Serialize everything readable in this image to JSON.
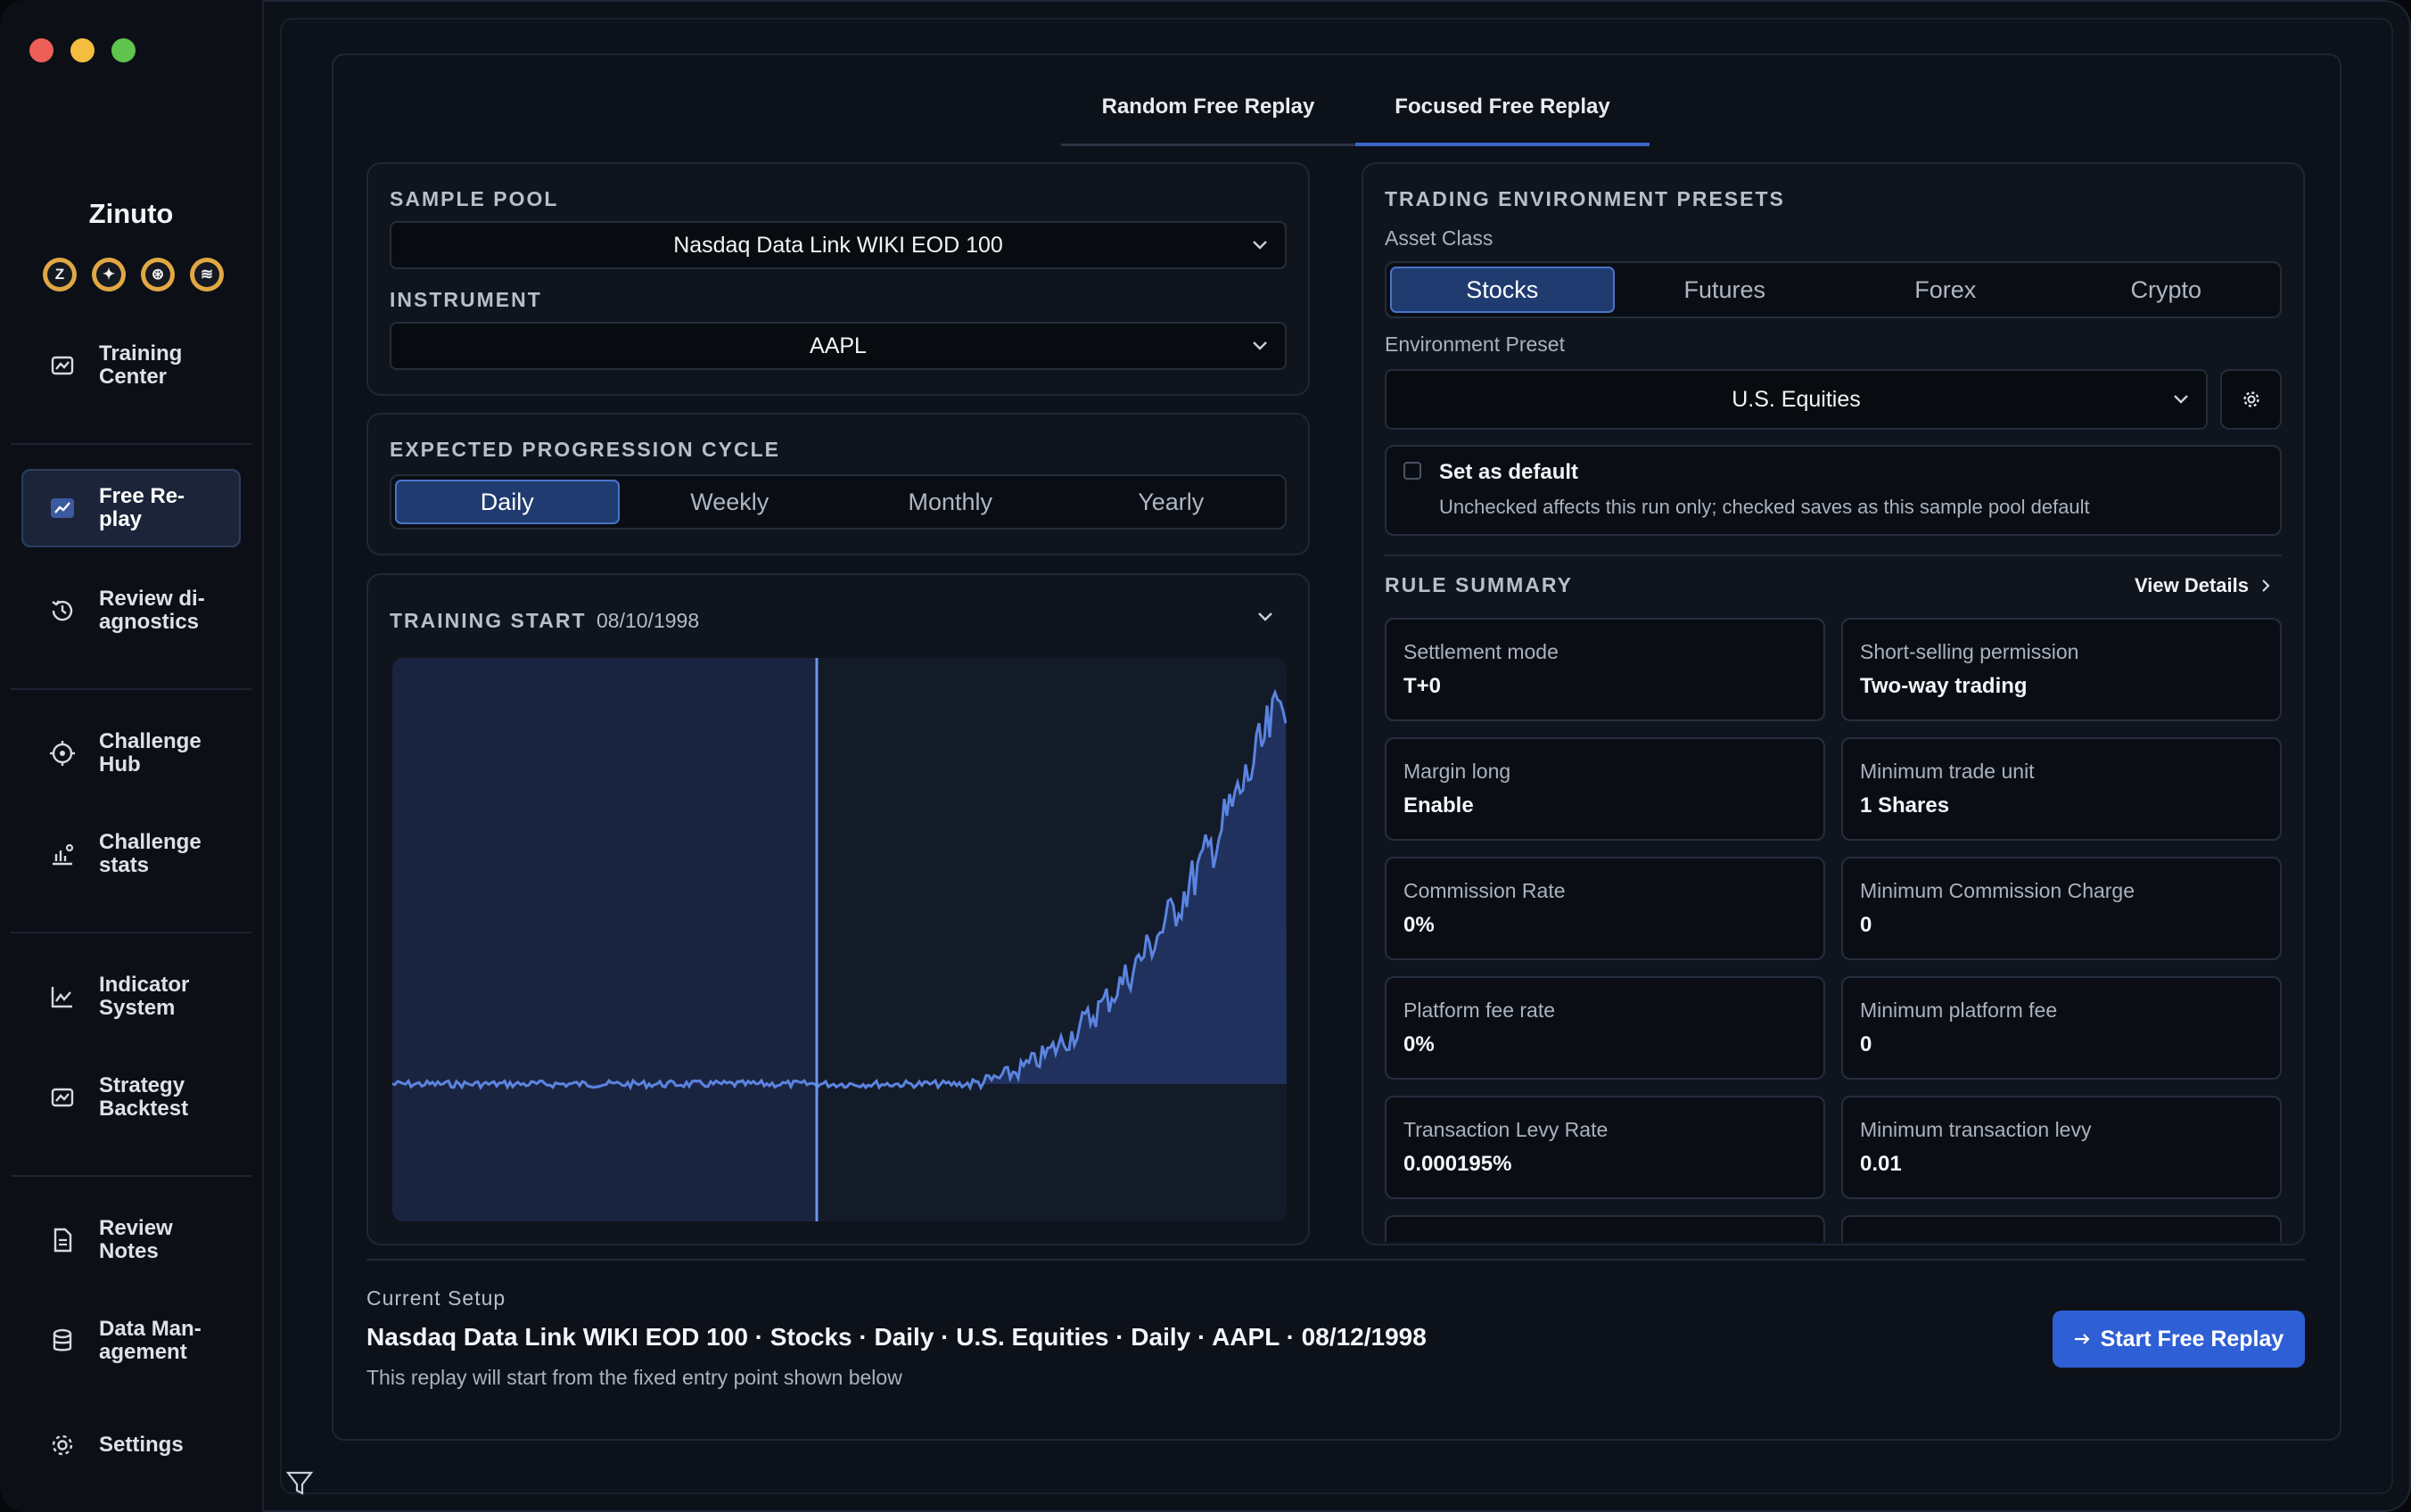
{
  "app": {
    "name": "Zinuto"
  },
  "sidebar": {
    "items": [
      {
        "label": "Training\nCenter"
      },
      {
        "label": "Free Re-\nplay"
      },
      {
        "label": "Review di-\nagnostics"
      },
      {
        "label": "Challenge\nHub"
      },
      {
        "label": "Challenge\nstats"
      },
      {
        "label": "Indicator\nSystem"
      },
      {
        "label": "Strategy\nBacktest"
      },
      {
        "label": "Review\nNotes"
      },
      {
        "label": "Data Man-\nagement"
      },
      {
        "label": "Settings"
      }
    ],
    "coins": [
      "Z",
      "✦",
      "⊛",
      "≋"
    ]
  },
  "tabs": [
    "Random Free Replay",
    "Focused Free Replay"
  ],
  "sample_pool": {
    "label": "SAMPLE POOL",
    "value": "Nasdaq Data Link WIKI EOD 100"
  },
  "instrument": {
    "label": "INSTRUMENT",
    "value": "AAPL"
  },
  "cycle": {
    "label": "EXPECTED PROGRESSION CYCLE",
    "options": [
      "Daily",
      "Weekly",
      "Monthly",
      "Yearly"
    ],
    "selected": "Daily"
  },
  "training_start": {
    "label": "TRAINING START",
    "date": "08/10/1998"
  },
  "trading_env": {
    "label": "TRADING ENVIRONMENT PRESETS",
    "asset_class_label": "Asset Class",
    "asset_classes": [
      "Stocks",
      "Futures",
      "Forex",
      "Crypto"
    ],
    "selected_asset": "Stocks",
    "env_preset_label": "Environment Preset",
    "env_preset": "U.S. Equities",
    "default_title": "Set as default",
    "default_desc": "Unchecked affects this run only; checked saves as this sample pool default"
  },
  "rule_summary": {
    "label": "RULE SUMMARY",
    "view_details": "View Details",
    "rules": [
      {
        "title": "Settlement mode",
        "value": "T+0"
      },
      {
        "title": "Short-selling permission",
        "value": "Two-way trading"
      },
      {
        "title": "Margin long",
        "value": "Enable"
      },
      {
        "title": "Minimum trade unit",
        "value": "1 Shares"
      },
      {
        "title": "Commission Rate",
        "value": "0%"
      },
      {
        "title": "Minimum Commission Charge",
        "value": "0"
      },
      {
        "title": "Platform fee rate",
        "value": "0%"
      },
      {
        "title": "Minimum platform fee",
        "value": "0"
      },
      {
        "title": "Transaction Levy Rate",
        "value": "0.000195%"
      },
      {
        "title": "Minimum transaction levy",
        "value": "0.01"
      }
    ]
  },
  "current_setup": {
    "label": "Current Setup",
    "summary": "Nasdaq Data Link WIKI EOD 100 · Stocks · Daily · U.S. Equities · Daily · AAPL · 08/12/1998",
    "note": "This replay will start from the fixed entry point shown below"
  },
  "start_button": "Start Free Replay",
  "colors": {
    "accent": "#2f5fd4",
    "chart_line": "#5b84e0",
    "chart_fill": "#1f2d52"
  }
}
